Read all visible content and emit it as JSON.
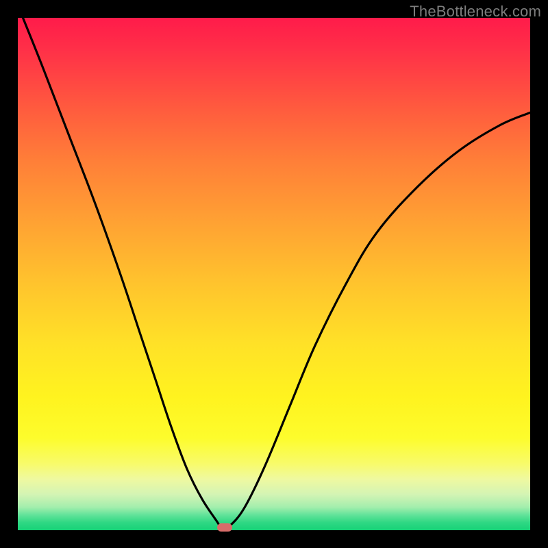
{
  "watermark": "TheBottleneck.com",
  "gradient_colors": {
    "top": "#ff1b4a",
    "mid_orange": "#ff9a34",
    "yellow": "#fff31f",
    "green": "#16d277"
  },
  "marker_color": "#d86d6a",
  "marker": {
    "x_frac": 0.404,
    "y_frac": 0.994
  },
  "chart_data": {
    "type": "line",
    "title": "",
    "xlabel": "",
    "ylabel": "",
    "xlim": [
      0,
      1
    ],
    "ylim": [
      0,
      1
    ],
    "grid": false,
    "legend": false,
    "series": [
      {
        "name": "curve",
        "x": [
          0.01,
          0.05,
          0.1,
          0.15,
          0.2,
          0.24,
          0.27,
          0.3,
          0.33,
          0.36,
          0.39,
          0.395,
          0.4,
          0.41,
          0.44,
          0.48,
          0.53,
          0.58,
          0.64,
          0.7,
          0.78,
          0.86,
          0.94,
          1.0
        ],
        "y": [
          1.0,
          0.9,
          0.77,
          0.64,
          0.5,
          0.38,
          0.29,
          0.2,
          0.12,
          0.06,
          0.015,
          0.005,
          0.0,
          0.005,
          0.04,
          0.12,
          0.24,
          0.36,
          0.48,
          0.58,
          0.67,
          0.74,
          0.79,
          0.815
        ],
        "note": "y measured as fraction from bottom (0) to top (1) of inner frame"
      }
    ],
    "marker_series": {
      "name": "marker",
      "points": [
        {
          "x": 0.404,
          "y": 0.006
        }
      ]
    }
  }
}
